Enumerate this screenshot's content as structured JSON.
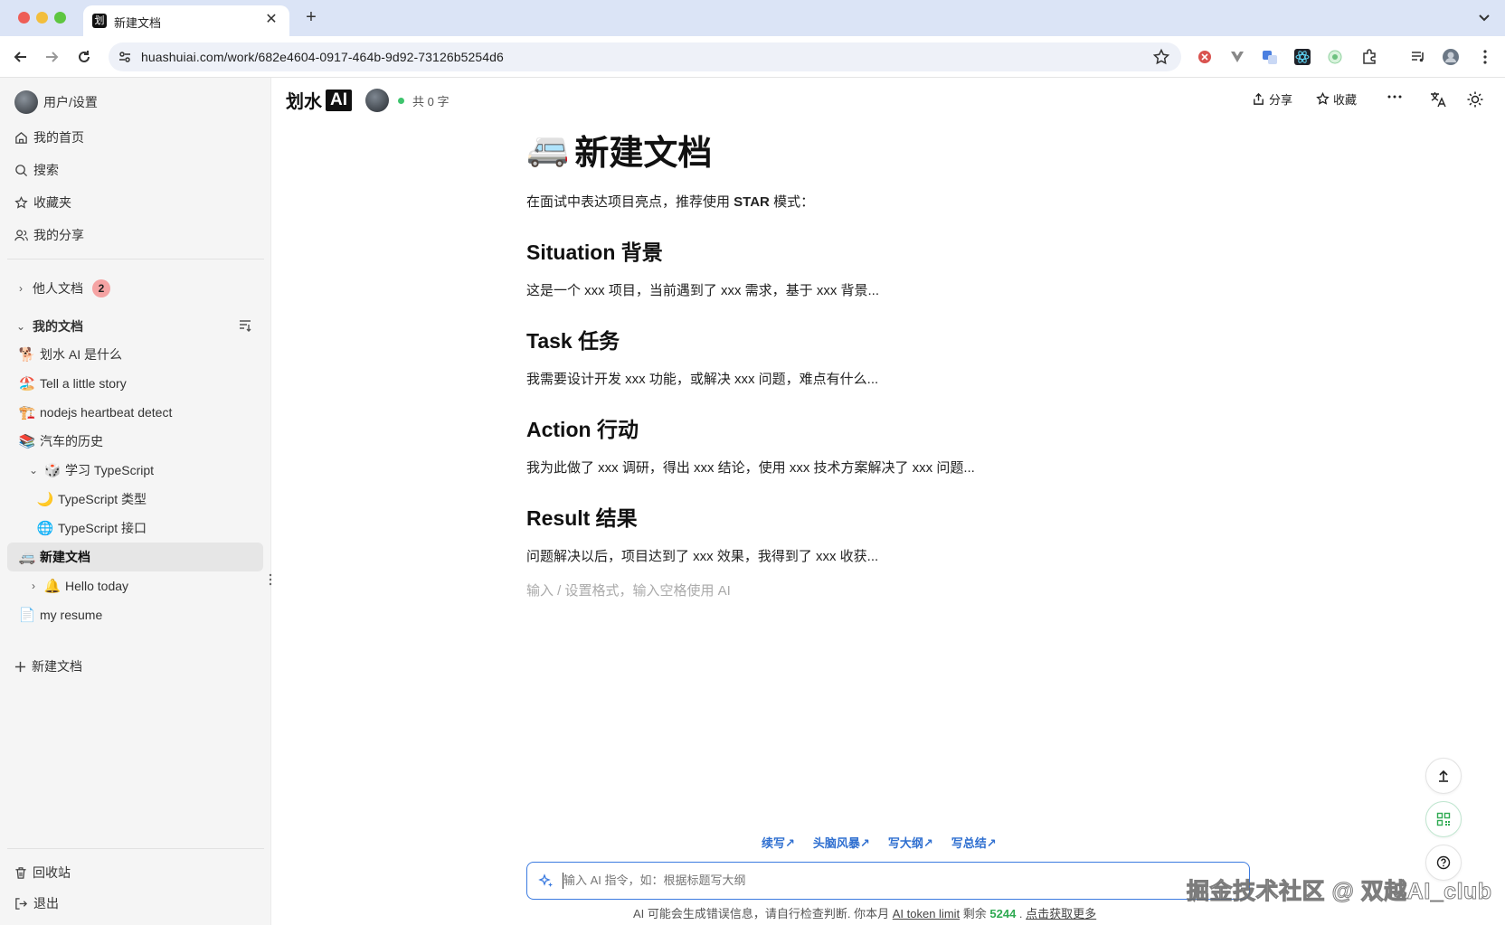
{
  "browser": {
    "tab_title": "新建文档",
    "tab_favicon": "划",
    "url": "huashuiai.com/work/682e4604-0917-464b-9d92-73126b5254d6"
  },
  "sidebar": {
    "user_settings": "用户/设置",
    "nav": [
      {
        "label": "我的首页",
        "icon": "home-icon"
      },
      {
        "label": "搜索",
        "icon": "search-icon"
      },
      {
        "label": "收藏夹",
        "icon": "star-icon"
      },
      {
        "label": "我的分享",
        "icon": "users-icon"
      }
    ],
    "others_docs": {
      "label": "他人文档",
      "count": "2"
    },
    "my_docs_label": "我的文档",
    "docs": [
      {
        "emoji": "🐕",
        "label": "划水 AI 是什么",
        "indent": 0,
        "chevron": ""
      },
      {
        "emoji": "🏖️",
        "label": "Tell a little story",
        "indent": 0,
        "chevron": ""
      },
      {
        "emoji": "🏗️",
        "label": "nodejs heartbeat detect",
        "indent": 0,
        "chevron": ""
      },
      {
        "emoji": "📚",
        "label": "汽车的历史",
        "indent": 0,
        "chevron": ""
      },
      {
        "emoji": "🎲",
        "label": "学习 TypeScript",
        "indent": 1,
        "chevron": "open"
      },
      {
        "emoji": "🌙",
        "label": "TypeScript 类型",
        "indent": 2,
        "chevron": ""
      },
      {
        "emoji": "🌐",
        "label": "TypeScript 接口",
        "indent": 2,
        "chevron": ""
      },
      {
        "emoji": "🚐",
        "label": "新建文档",
        "indent": 0,
        "chevron": "",
        "active": true
      },
      {
        "emoji": "🔔",
        "label": "Hello today",
        "indent": 1,
        "chevron": "closed"
      },
      {
        "emoji": "📄",
        "label": "my resume",
        "indent": 0,
        "chevron": ""
      }
    ],
    "new_doc": "新建文档",
    "trash": "回收站",
    "logout": "退出"
  },
  "header": {
    "logo_text": "划水",
    "logo_ai": "AI",
    "word_count": "共 0 字",
    "share": "分享",
    "favorite": "收藏"
  },
  "document": {
    "title_emoji": "🚐",
    "title": "新建文档",
    "intro_prefix": "在面试中表达项目亮点，推荐使用 ",
    "intro_bold": "STAR",
    "intro_suffix": " 模式：",
    "sections": [
      {
        "heading": "Situation 背景",
        "body": "这是一个 xxx 项目，当前遇到了 xxx 需求，基于 xxx 背景..."
      },
      {
        "heading": "Task 任务",
        "body": "我需要设计开发 xxx 功能，或解决 xxx 问题，难点有什么..."
      },
      {
        "heading": "Action 行动",
        "body": "我为此做了 xxx 调研，得出 xxx 结论，使用 xxx 技术方案解决了 xxx 问题..."
      },
      {
        "heading": "Result 结果",
        "body": "问题解决以后，项目达到了 xxx 效果，我得到了 xxx 收获..."
      }
    ],
    "placeholder": "输入 / 设置格式，输入空格使用 AI"
  },
  "ai": {
    "quick_actions": [
      "续写↗",
      "头脑风暴↗",
      "写大纲↗",
      "写总结↗"
    ],
    "input_placeholder": "输入 AI 指令，如：根据标题写大纲",
    "footer_prefix": "AI 可能会生成错误信息，请自行检查判断. 你本月 ",
    "footer_link": "AI token limit",
    "footer_mid": " 剩余 ",
    "footer_tokens": "5244",
    "footer_sep": " . ",
    "footer_more": "点击获取更多"
  },
  "watermark": "掘金技术社区 @ 双越AI_club",
  "colors": {
    "accent": "#3c7be0",
    "token_green": "#2faa52",
    "badge_red": "#f5a3a3",
    "online_green": "#3ec46d"
  }
}
